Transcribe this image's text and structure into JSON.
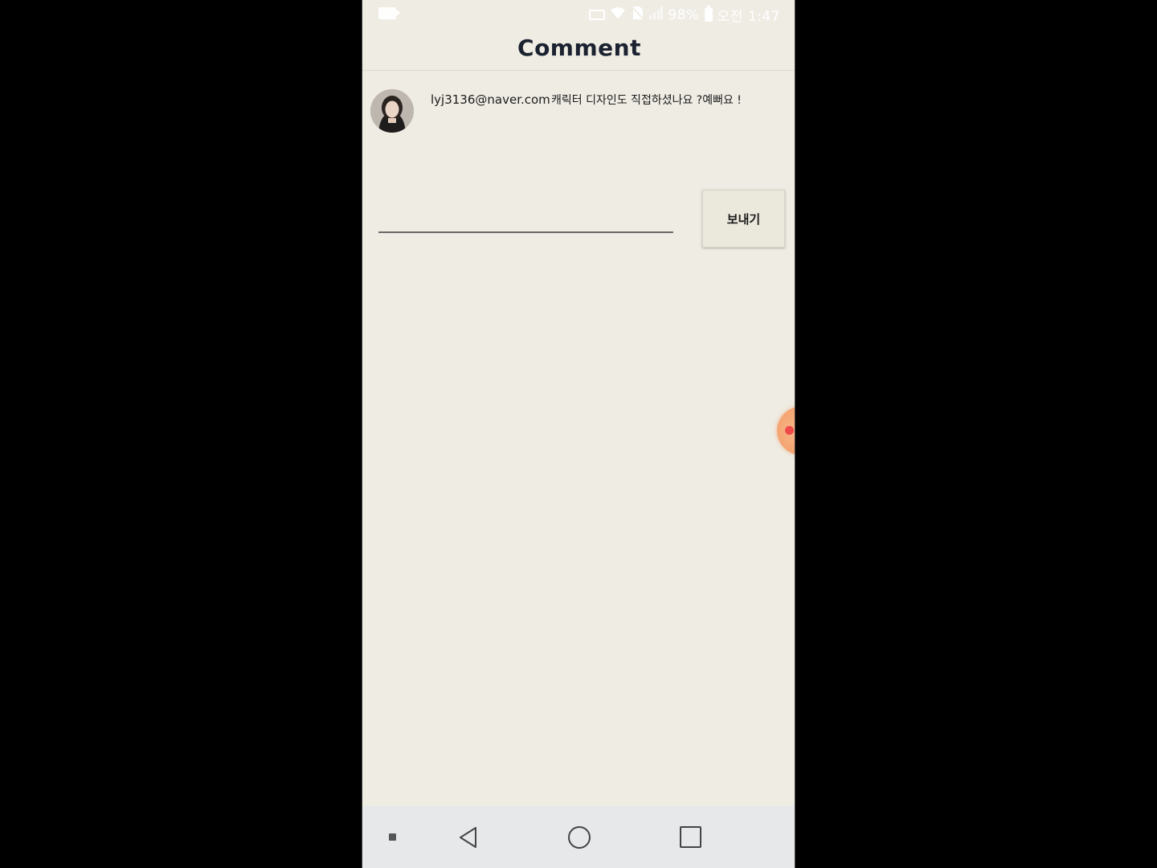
{
  "status_bar": {
    "battery_text": "98%",
    "time": "오전 1:47",
    "icons": [
      "video-record-icon",
      "nfc-icon",
      "wifi-icon",
      "no-sim-icon",
      "signal-icon",
      "battery-icon"
    ]
  },
  "header": {
    "title": "Comment"
  },
  "comments": [
    {
      "avatar": "user-avatar",
      "email": "lyj3136@naver.com",
      "text": "캐릭터 디자인도 직접하셨나요 ?예뻐요 !"
    }
  ],
  "composer": {
    "input_value": "",
    "send_label": "보내기"
  },
  "nav_bar": {
    "items": [
      "menu-dot-icon",
      "back-icon",
      "home-icon",
      "recents-icon"
    ]
  },
  "colors": {
    "background": "#efece4",
    "title_text": "#1b2230",
    "nav_bar": "#e6e8ea",
    "bubble": "#f4a36f"
  }
}
